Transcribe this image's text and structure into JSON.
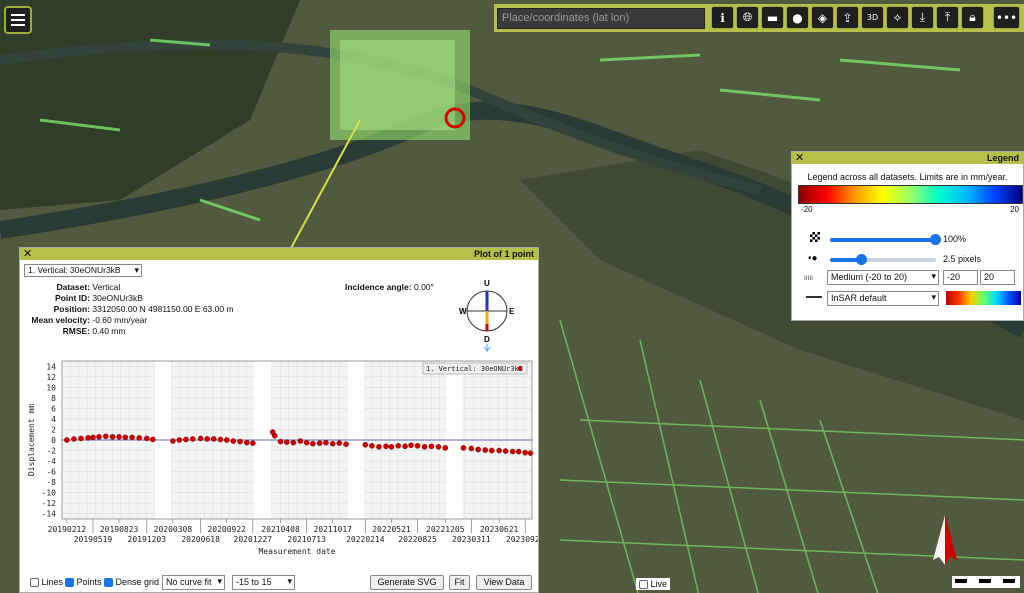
{
  "search": {
    "placeholder": "Place/coordinates (lat lon)"
  },
  "toolbar": {
    "icons": [
      "info-icon",
      "globe-icon",
      "ruler-icon",
      "layers-icon",
      "compass-icon",
      "share-icon",
      "3d-icon",
      "network-icon",
      "download-icon",
      "upload-icon",
      "lock-icon",
      "more-icon"
    ]
  },
  "legend": {
    "title": "Legend",
    "caption": "Legend across all datasets. Limits are in mm/year.",
    "min": "-20",
    "max": "20",
    "opacity": "100%",
    "point_size": "2.5 pixels",
    "range_select": "Medium (-20 to 20)",
    "range_min": "-20",
    "range_max": "20",
    "palette_select": "InSAR default",
    "colors": {
      "accent": "#b4c04a",
      "slider": "#1a73e8"
    }
  },
  "plot": {
    "title": "Plot of 1 point",
    "dataset_select": "1. Vertical: 30eONUr3kB",
    "dataset_label": "Dataset:",
    "dataset": "Vertical",
    "point_id_label": "Point ID:",
    "point_id": "30eONUr3kB",
    "position_label": "Position:",
    "position": "3312050.00 N 4981150.00 E 63.00 m",
    "velocity_label": "Mean velocity:",
    "velocity": "-0.60 mm/year",
    "rmse_label": "RMSE:",
    "rmse": "0.40 mm",
    "incidence_label": "Incidence angle:",
    "incidence": "0.00°",
    "compass": {
      "n": "U",
      "s": "D",
      "w": "W",
      "e": "E"
    },
    "lines_label": "Lines",
    "points_label": "Points",
    "dense_label": "Dense grid",
    "curve_select": "No curve fit",
    "range_select": "-15 to 15",
    "svg_button": "Generate SVG",
    "fit_button": "Fit",
    "view_button": "View Data"
  },
  "live_label": "Live",
  "chart_data": {
    "type": "scatter",
    "xlabel": "Measurement date",
    "ylabel": "Displacement mm",
    "ylim": [
      -15,
      15
    ],
    "y_ticks": [
      14,
      12,
      10,
      8,
      6,
      4,
      2,
      0,
      -2,
      -4,
      -6,
      -8,
      -10,
      -12,
      -14
    ],
    "grid": true,
    "legend": {
      "position": "top-right",
      "label": "1. Vertical: 30eONUr3kB"
    },
    "x_ticks_top": [
      "20190212",
      "20190823",
      "20200308",
      "20200922",
      "20210408",
      "20211017",
      "20220521",
      "20221205",
      "20230621"
    ],
    "x_ticks_bottom": [
      "20190519",
      "20191203",
      "20200618",
      "20201227",
      "20210713",
      "20220214",
      "20220825",
      "20230311",
      "20230925"
    ],
    "x_range": [
      "2019-01-25",
      "2023-10-20"
    ],
    "series": [
      {
        "name": "1. Vertical: 30eONUr3kB",
        "color": "#cc0000",
        "points": [
          [
            "2019-02-12",
            0.0
          ],
          [
            "2019-03-10",
            0.2
          ],
          [
            "2019-04-05",
            0.3
          ],
          [
            "2019-05-01",
            0.4
          ],
          [
            "2019-05-19",
            0.5
          ],
          [
            "2019-06-10",
            0.6
          ],
          [
            "2019-07-05",
            0.7
          ],
          [
            "2019-07-30",
            0.6
          ],
          [
            "2019-08-23",
            0.6
          ],
          [
            "2019-09-15",
            0.5
          ],
          [
            "2019-10-10",
            0.5
          ],
          [
            "2019-11-05",
            0.4
          ],
          [
            "2019-12-03",
            0.3
          ],
          [
            "2019-12-25",
            0.1
          ],
          [
            "2020-03-08",
            -0.2
          ],
          [
            "2020-04-01",
            0.0
          ],
          [
            "2020-04-25",
            0.1
          ],
          [
            "2020-05-20",
            0.2
          ],
          [
            "2020-06-18",
            0.3
          ],
          [
            "2020-07-12",
            0.2
          ],
          [
            "2020-08-05",
            0.2
          ],
          [
            "2020-08-30",
            0.1
          ],
          [
            "2020-09-22",
            0.0
          ],
          [
            "2020-10-16",
            -0.2
          ],
          [
            "2020-11-10",
            -0.3
          ],
          [
            "2020-12-05",
            -0.5
          ],
          [
            "2020-12-27",
            -0.6
          ],
          [
            "2021-03-10",
            1.5
          ],
          [
            "2021-03-18",
            0.8
          ],
          [
            "2021-04-08",
            -0.3
          ],
          [
            "2021-05-01",
            -0.4
          ],
          [
            "2021-05-25",
            -0.5
          ],
          [
            "2021-06-20",
            -0.2
          ],
          [
            "2021-07-13",
            -0.5
          ],
          [
            "2021-08-05",
            -0.7
          ],
          [
            "2021-08-30",
            -0.6
          ],
          [
            "2021-09-22",
            -0.5
          ],
          [
            "2021-10-17",
            -0.7
          ],
          [
            "2021-11-10",
            -0.6
          ],
          [
            "2021-12-05",
            -0.8
          ],
          [
            "2022-02-14",
            -0.9
          ],
          [
            "2022-03-10",
            -1.1
          ],
          [
            "2022-04-05",
            -1.3
          ],
          [
            "2022-05-01",
            -1.2
          ],
          [
            "2022-05-21",
            -1.3
          ],
          [
            "2022-06-15",
            -1.1
          ],
          [
            "2022-07-10",
            -1.2
          ],
          [
            "2022-08-01",
            -1.0
          ],
          [
            "2022-08-25",
            -1.1
          ],
          [
            "2022-09-20",
            -1.3
          ],
          [
            "2022-10-15",
            -1.2
          ],
          [
            "2022-11-10",
            -1.3
          ],
          [
            "2022-12-05",
            -1.5
          ],
          [
            "2023-02-10",
            -1.5
          ],
          [
            "2023-03-11",
            -1.6
          ],
          [
            "2023-04-05",
            -1.8
          ],
          [
            "2023-05-01",
            -1.9
          ],
          [
            "2023-05-25",
            -2.0
          ],
          [
            "2023-06-21",
            -2.0
          ],
          [
            "2023-07-15",
            -2.1
          ],
          [
            "2023-08-10",
            -2.2
          ],
          [
            "2023-09-01",
            -2.2
          ],
          [
            "2023-09-25",
            -2.4
          ],
          [
            "2023-10-15",
            -2.5
          ]
        ]
      }
    ],
    "gaps": [
      [
        "2020-01-01",
        "2020-03-01"
      ],
      [
        "2020-12-30",
        "2021-03-05"
      ],
      [
        "2021-12-10",
        "2022-02-10"
      ],
      [
        "2022-12-08",
        "2023-02-05"
      ]
    ]
  }
}
